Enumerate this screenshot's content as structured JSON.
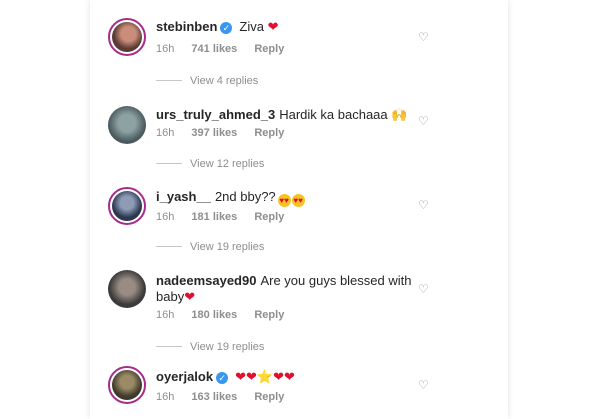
{
  "comments": [
    {
      "username": "stebinben",
      "verified": true,
      "text": "Ziva",
      "emoji": "❤",
      "time": "16h",
      "likes": "741 likes",
      "reply_label": "Reply",
      "view_replies": "View 4 replies",
      "avatar_colors": [
        "#5a3a33",
        "#c98d79"
      ]
    },
    {
      "username": "urs_truly_ahmed_3",
      "verified": false,
      "text": "Hardik ka bachaaa",
      "emoji": "🙌",
      "time": "16h",
      "likes": "397 likes",
      "reply_label": "Reply",
      "view_replies": "View 12 replies",
      "avatar_colors": [
        "#4a5a5e",
        "#8ea2a3"
      ]
    },
    {
      "username": "i_yash__",
      "verified": false,
      "text": "2nd bby??",
      "emoji": "😍😍",
      "time": "16h",
      "likes": "181 likes",
      "reply_label": "Reply",
      "view_replies": "View 19 replies",
      "avatar_colors": [
        "#2b3650",
        "#8d9bb5"
      ]
    },
    {
      "username": "nadeemsayed90",
      "verified": false,
      "text": "Are you guys blessed with",
      "text2": "baby",
      "emoji": "❤",
      "time": "16h",
      "likes": "180 likes",
      "reply_label": "Reply",
      "view_replies": "View 19 replies",
      "avatar_colors": [
        "#3b3b3b",
        "#9a8c84"
      ]
    },
    {
      "username": "oyerjalok",
      "verified": true,
      "text": "",
      "emoji": "❤❤⭐❤❤",
      "time": "16h",
      "likes": "163 likes",
      "reply_label": "Reply",
      "avatar_colors": [
        "#3e3a2c",
        "#9b8a66"
      ]
    }
  ],
  "colors": {
    "verified_badge": "#3897f0",
    "avatar_ring": "#a52b8c",
    "heart": "#e0102f",
    "muted_text": "#8e8e8e"
  },
  "icons": {
    "like": "heart-outline-icon",
    "verified": "verified-badge-icon"
  }
}
